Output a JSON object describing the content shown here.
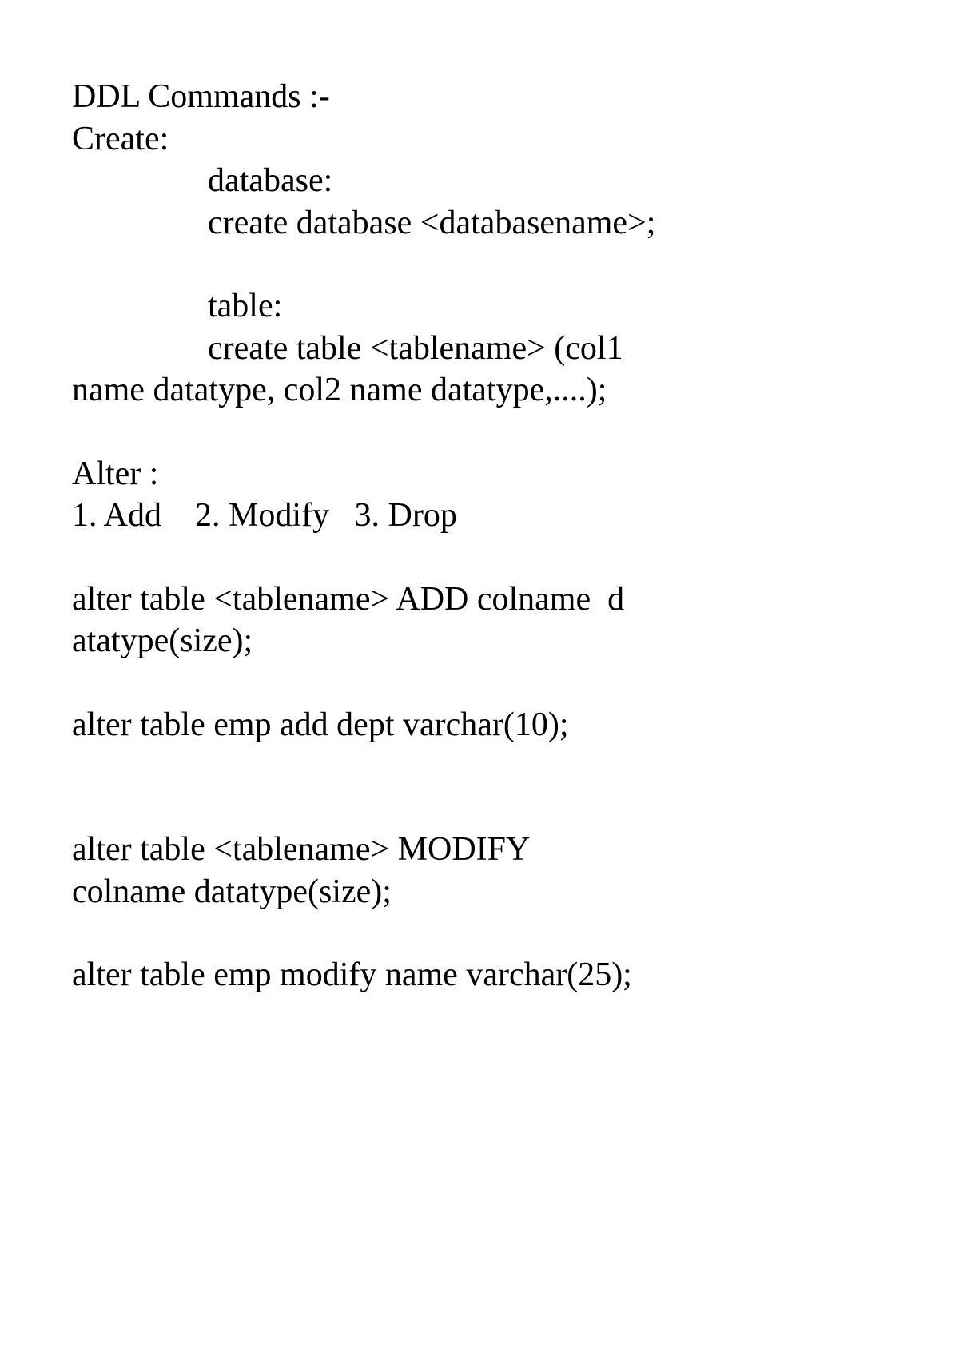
{
  "doc": {
    "title": "DDL Commands :-",
    "create_heading": "Create:",
    "database_label": "database:",
    "create_db_syntax": "create database <databasename>;",
    "table_label": "table:",
    "create_table_syntax_l1": "create table <tablename> (col1",
    "create_table_syntax_l2": "name datatype, col2 name datatype,....);",
    "alter_heading": "Alter :",
    "alter_options": "1. Add    2. Modify   3. Drop",
    "alter_add_syntax_l1": "alter table <tablename> ADD colname  d",
    "alter_add_syntax_l2": "atatype(size);",
    "alter_add_example": "alter table emp add dept varchar(10);",
    "alter_modify_syntax_l1": "alter table <tablename> MODIFY",
    "alter_modify_syntax_l2": "colname datatype(size);",
    "alter_modify_example": "alter table emp modify name varchar(25);"
  }
}
